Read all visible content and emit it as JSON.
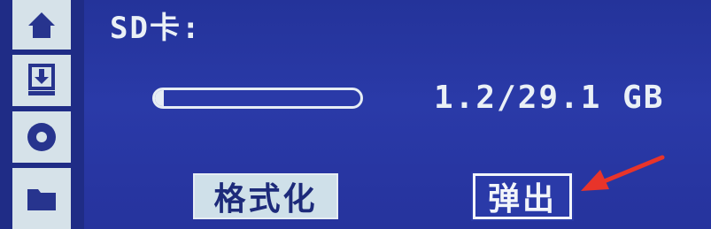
{
  "sidebar": {
    "items": [
      {
        "icon": "home-icon"
      },
      {
        "icon": "download-icon"
      },
      {
        "icon": "disc-icon"
      },
      {
        "icon": "folder-icon"
      }
    ]
  },
  "storage": {
    "title": "SD卡:",
    "used_gb": 1.2,
    "total_gb": 29.1,
    "usage_text": "1.2/29.1 GB"
  },
  "actions": {
    "format_label": "格式化",
    "eject_label": "弹出"
  },
  "colors": {
    "screen_bg": "#2a3aa8",
    "foreground": "#e6edf4",
    "annotation": "#e8342a"
  }
}
